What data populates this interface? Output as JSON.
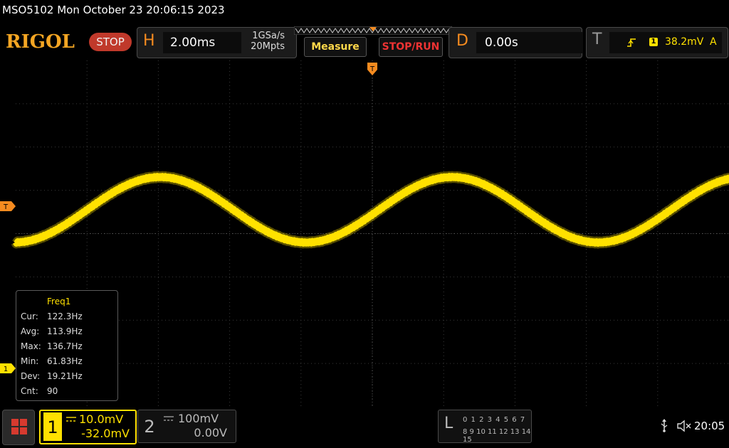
{
  "header": {
    "title_line": "MSO5102  Mon October 23 20:06:15 2023",
    "logo": "RIGOL",
    "run_state": "STOP"
  },
  "horizontal": {
    "letter": "H",
    "time_scale": "2.00ms",
    "sample_rate": "1GSa/s",
    "memory_depth": "20Mpts"
  },
  "buttons": {
    "measure": "Measure",
    "stop_run": "STOP/RUN"
  },
  "delay": {
    "letter": "D",
    "value": "0.00s"
  },
  "trigger": {
    "letter": "T",
    "source": "1",
    "level": "38.2mV",
    "mode": "A",
    "position_marker": "T",
    "level_marker": "T"
  },
  "channel_markers": {
    "ch1": "1"
  },
  "measurement": {
    "title": "Freq1",
    "rows": [
      {
        "label": "Cur:",
        "value": "122.3Hz"
      },
      {
        "label": "Avg:",
        "value": "113.9Hz"
      },
      {
        "label": "Max:",
        "value": "136.7Hz"
      },
      {
        "label": "Min:",
        "value": "61.83Hz"
      },
      {
        "label": "Dev:",
        "value": "19.21Hz"
      },
      {
        "label": "Cnt:",
        "value": "90"
      }
    ]
  },
  "channel1": {
    "number": "1",
    "scale": "10.0mV",
    "offset": "-32.0mV"
  },
  "channel2": {
    "number": "2",
    "scale": "100mV",
    "offset": "0.00V"
  },
  "logic": {
    "letter": "L",
    "row1": "0 1 2 3  4 5 6 7",
    "row2": "8 9 10 11 12 13 14 15"
  },
  "status": {
    "clock": "20:05"
  },
  "colors": {
    "channel1": "#ffe100",
    "accent_orange": "#f58b1f",
    "stop_red": "#c0392b"
  },
  "waveform": {
    "channel": "1",
    "shape": "noisy sine, approx 2.1 cycles on screen"
  }
}
